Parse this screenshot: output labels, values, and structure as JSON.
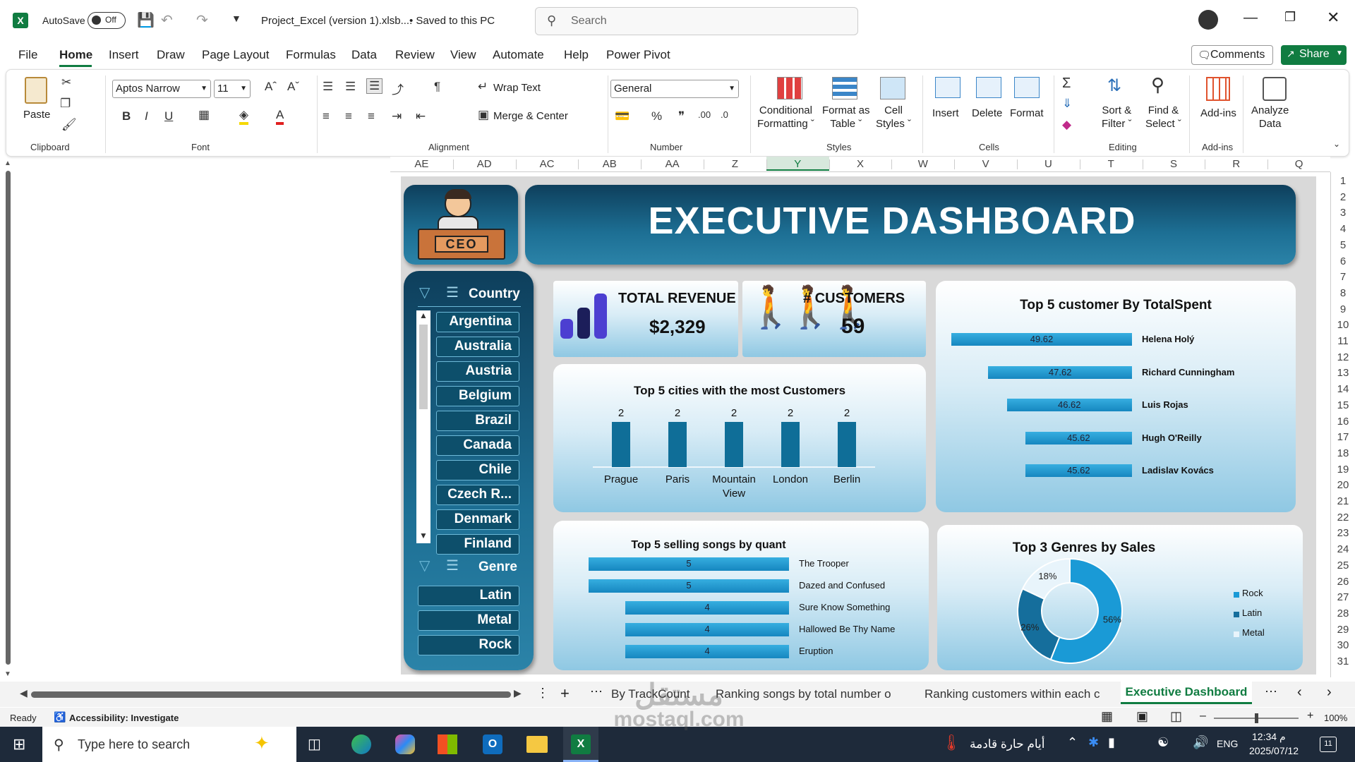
{
  "titlebar": {
    "autosave_label": "AutoSave",
    "autosave_state": "Off",
    "filename": "Project_Excel (version 1).xlsb....",
    "save_status": "• Saved to this PC",
    "search_placeholder": "Search"
  },
  "menu_tabs": [
    "File",
    "Home",
    "Insert",
    "Draw",
    "Page Layout",
    "Formulas",
    "Data",
    "Review",
    "View",
    "Automate",
    "Help",
    "Power Pivot"
  ],
  "comments_label": "Comments",
  "share_label": "Share",
  "ribbon": {
    "clipboard": {
      "paste": "Paste",
      "group": "Clipboard"
    },
    "font": {
      "name": "Aptos Narrow",
      "size": "11",
      "group": "Font"
    },
    "alignment": {
      "wrap": "Wrap Text",
      "merge": "Merge & Center",
      "group": "Alignment"
    },
    "number": {
      "format": "General",
      "group": "Number"
    },
    "styles": {
      "cond1": "Conditional",
      "cond2": "Formatting",
      "fmt1": "Format as",
      "fmt2": "Table",
      "cell1": "Cell",
      "cell2": "Styles",
      "group": "Styles"
    },
    "cells": {
      "insert": "Insert",
      "delete": "Delete",
      "format": "Format",
      "group": "Cells"
    },
    "editing": {
      "sort1": "Sort &",
      "sort2": "Filter",
      "find1": "Find &",
      "find2": "Select",
      "group": "Editing"
    },
    "addins": {
      "label": "Add-ins",
      "group": "Add-ins"
    },
    "analyze": {
      "l1": "Analyze",
      "l2": "Data"
    }
  },
  "columns": [
    "AE",
    "AD",
    "AC",
    "AB",
    "AA",
    "Z",
    "Y",
    "X",
    "W",
    "V",
    "U",
    "T",
    "S",
    "R",
    "Q"
  ],
  "rows": [
    "1",
    "2",
    "3",
    "4",
    "5",
    "6",
    "7",
    "8",
    "9",
    "10",
    "11",
    "12",
    "13",
    "14",
    "15",
    "16",
    "17",
    "18",
    "19",
    "20",
    "21",
    "22",
    "23",
    "24",
    "25",
    "26",
    "27",
    "28",
    "29",
    "30",
    "31"
  ],
  "dashboard": {
    "title": "EXECUTIVE DASHBOARD",
    "ceo_sign": "CEO",
    "country_slicer": {
      "title": "Country",
      "items": [
        "Argentina",
        "Australia",
        "Austria",
        "Belgium",
        "Brazil",
        "Canada",
        "Chile",
        "Czech R...",
        "Denmark",
        "Finland"
      ]
    },
    "genre_slicer": {
      "title": "Genre",
      "items": [
        "Latin",
        "Metal",
        "Rock"
      ]
    },
    "kpi_revenue": {
      "label": "TOTAL REVENUE",
      "value": "$2,329"
    },
    "kpi_customers": {
      "label": "# CUSTOMERS",
      "value": "59"
    }
  },
  "chart_data": [
    {
      "type": "bar",
      "title": "Top 5 cities with the most Customers",
      "categories": [
        "Prague",
        "Paris",
        "Mountain View",
        "London",
        "Berlin"
      ],
      "values": [
        2,
        2,
        2,
        2,
        2
      ],
      "ylim": [
        0,
        2
      ]
    },
    {
      "type": "bar",
      "orientation": "horizontal",
      "title": "Top 5 customer  By TotalSpent",
      "categories": [
        "Helena Holý",
        "Richard Cunningham",
        "Luis Rojas",
        "Hugh O'Reilly",
        "Ladislav Kovács"
      ],
      "values": [
        49.62,
        47.62,
        46.62,
        45.62,
        45.62
      ],
      "value_labels": [
        "49.62",
        "47.62",
        "46.62",
        "45.62",
        "45.62"
      ]
    },
    {
      "type": "bar",
      "orientation": "horizontal",
      "title": "Top 5 selling songs by quant",
      "categories": [
        "The Trooper",
        "Dazed and Confused",
        "Sure Know Something",
        "Hallowed Be Thy Name",
        "Eruption"
      ],
      "values": [
        5,
        5,
        4,
        4,
        4
      ],
      "value_labels": [
        "5",
        "5",
        "4",
        "4",
        "4"
      ]
    },
    {
      "type": "pie",
      "donut": true,
      "title": "Top 3 Genres by Sales",
      "categories": [
        "Rock",
        "Latin",
        "Metal"
      ],
      "values": [
        56,
        26,
        18
      ],
      "value_labels": [
        "56%",
        "26%",
        "18%"
      ],
      "colors": [
        "#1a9ad6",
        "#156e9c",
        "#e8f4fb"
      ],
      "legend": "right"
    }
  ],
  "sheet_tabs": {
    "items": [
      "By TrackCount",
      "Ranking songs by total number o",
      "Ranking customers within each c",
      "Executive Dashboard"
    ],
    "active": "Executive Dashboard"
  },
  "status": {
    "ready": "Ready",
    "accessibility": "Accessibility: Investigate",
    "zoom": "100%"
  },
  "taskbar": {
    "search": "Type here to search",
    "weather": "أيام حارة قادمة",
    "lang": "ENG",
    "time": "12:34 م",
    "date": "2025/07/12",
    "notif": "11"
  },
  "watermark": {
    "arabic": "مستقل",
    "latin": "mostaql.com"
  },
  "colors": {
    "excel_green": "#107c41",
    "navy": "#0e3f5c",
    "bar_blue": "#1687c0"
  }
}
